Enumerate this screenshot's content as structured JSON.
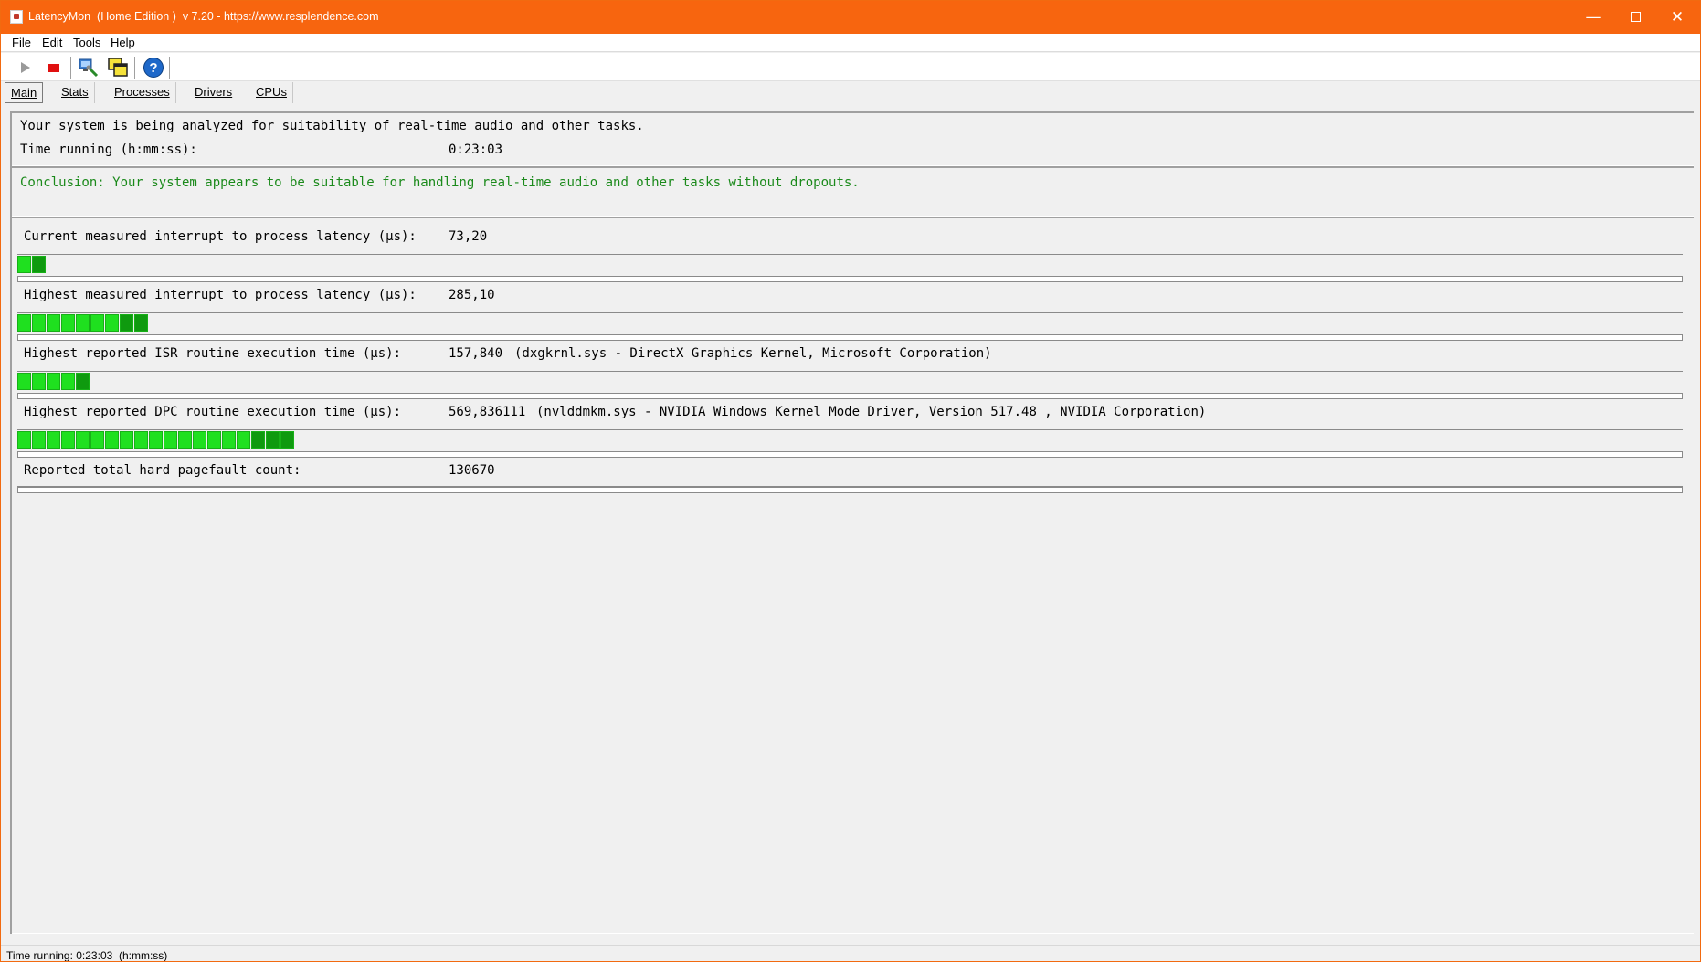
{
  "window": {
    "title": "LatencyMon  (Home Edition )  v 7.20 - https://www.resplendence.com",
    "minimize": "—",
    "close": "✕"
  },
  "menu": [
    "File",
    "Edit",
    "Tools",
    "Help"
  ],
  "toolbar": {
    "help_glyph": "?"
  },
  "tabs": [
    "Main",
    "Stats",
    "Processes",
    "Drivers",
    "CPUs"
  ],
  "status": {
    "analyzing_text": "Your system is being analyzed for suitability of real-time audio and other tasks.",
    "time_label": "Time running (h:mm:ss):",
    "time_value": "0:23:03",
    "conclusion": "Conclusion: Your system appears to be suitable for handling real-time audio and other tasks without dropouts."
  },
  "metrics": [
    {
      "label": "Current measured interrupt to process latency (µs):",
      "value": "73,20",
      "detail": "",
      "segments": 2
    },
    {
      "label": "Highest measured interrupt to process latency (µs):",
      "value": "285,10",
      "detail": "",
      "segments": 9
    },
    {
      "label": "Highest reported ISR routine execution time (µs):",
      "value": "157,840",
      "detail": "(dxgkrnl.sys - DirectX Graphics Kernel, Microsoft Corporation)",
      "segments": 5
    },
    {
      "label": "Highest reported DPC routine execution time (µs):",
      "value": "569,836111",
      "detail": "(nvlddmkm.sys - NVIDIA Windows Kernel Mode Driver, Version 517.48 , NVIDIA Corporation)",
      "segments": 19
    },
    {
      "label": "Reported total hard pagefault count:",
      "value": "130670",
      "detail": "",
      "segments": 0
    }
  ],
  "statusbar": "Time running: 0:23:03  (h:mm:ss)",
  "colors": {
    "titlebar": "#f7650f",
    "conclusion": "#1b8a1b",
    "bar_light": "#1fe01f",
    "bar_dark": "#0f9a0f"
  }
}
